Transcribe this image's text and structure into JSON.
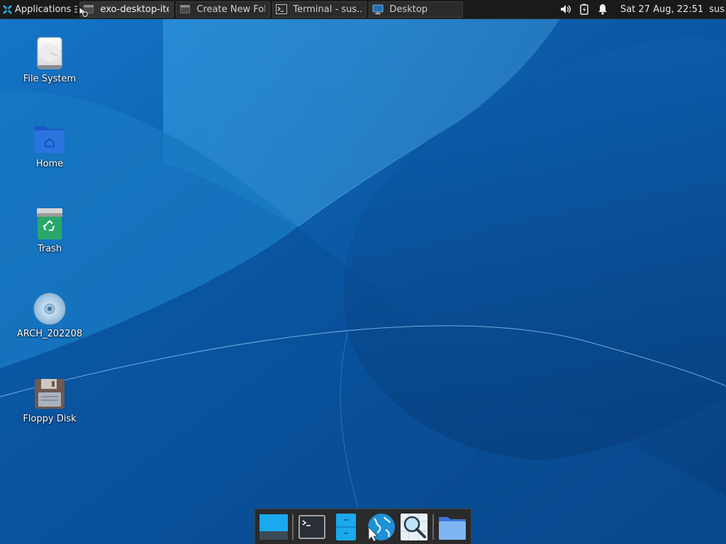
{
  "panel": {
    "applications_label": "Applications",
    "tasks": [
      {
        "label": "exo-desktop-ite...",
        "icon": "window-icon",
        "active": true
      },
      {
        "label": "Create New Fol...",
        "icon": "window-icon",
        "active": false
      },
      {
        "label": "Terminal - sus...",
        "icon": "terminal-icon",
        "active": false
      },
      {
        "label": "Desktop",
        "icon": "desktop-icon",
        "active": false
      }
    ],
    "tray": {
      "volume_icon": "speaker-icon",
      "battery_icon": "battery-icon",
      "notifications_icon": "bell-icon"
    },
    "clock": "Sat 27 Aug, 22:51",
    "user": "sus"
  },
  "desktop": {
    "icons": [
      {
        "label": "File System",
        "icon": "drive-harddisk-icon"
      },
      {
        "label": "Home",
        "icon": "home-folder-icon"
      },
      {
        "label": "Trash",
        "icon": "trash-icon"
      },
      {
        "label": "ARCH_202208",
        "icon": "optical-disc-icon"
      },
      {
        "label": "Floppy Disk",
        "icon": "floppy-disk-icon"
      }
    ]
  },
  "dock": {
    "items": [
      {
        "name": "show-desktop",
        "icon": "show-desktop-icon"
      },
      {
        "name": "terminal",
        "icon": "terminal-icon"
      },
      {
        "name": "file-manager",
        "icon": "file-cabinet-icon"
      },
      {
        "name": "web-browser",
        "icon": "globe-icon"
      },
      {
        "name": "app-finder",
        "icon": "magnifier-icon"
      },
      {
        "name": "home-folder",
        "icon": "folder-icon"
      }
    ]
  },
  "colors": {
    "panel_bg": "#1a1a1a",
    "wallpaper_base": "#0a4f93",
    "accent": "#2aa9e6"
  }
}
